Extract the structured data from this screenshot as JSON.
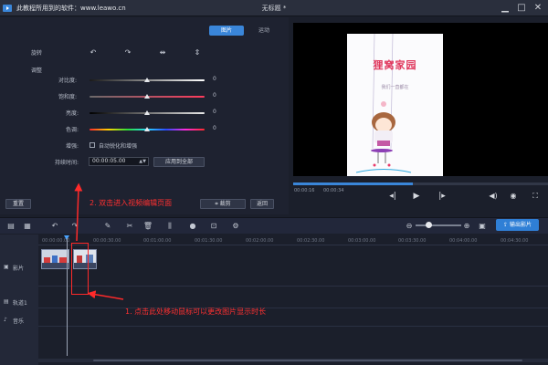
{
  "titlebar": {
    "watermark": "此教程所用到的软件：www.leawo.cn",
    "doc_title": "无标题 *",
    "minimize": "▁",
    "maximize": "□",
    "close": "✕"
  },
  "tabs": {
    "active": "图片",
    "inactive": "运动"
  },
  "props": {
    "rotate_label": "旋转",
    "adjust_label": "调整",
    "contrast": {
      "label": "对比度:",
      "value": "0",
      "level": 0.5
    },
    "saturation": {
      "label": "饱和度:",
      "value": "0",
      "level": 0.5
    },
    "brightness": {
      "label": "亮度:",
      "value": "0",
      "level": 0.5
    },
    "hue": {
      "label": "色调:",
      "value": "0",
      "level": 0.5
    },
    "enhance_label": "增强:",
    "auto_enhance": "自动锐化和增强",
    "duration_label": "持续时间:",
    "duration_value": "00:00:05.00",
    "apply_all": "应用到全部",
    "reset": "重置",
    "crop": "裁剪",
    "back": "返回"
  },
  "preview": {
    "card_title": "狸窝家园",
    "card_sub": "我们一直都在",
    "time_current": "00:00:16",
    "time_total": "00:00:34",
    "progress": 0.47
  },
  "toolbar": {
    "export_label": "输出影片"
  },
  "timeline": {
    "ruler_ticks": [
      "00:00:00.00",
      "00:00:30.00",
      "00:01:00.00",
      "00:01:30.00",
      "00:02:00.00",
      "00:02:30.00",
      "00:03:00.00",
      "00:03:30.00",
      "00:04:00.00",
      "00:04:30.00"
    ],
    "track_video": "影片",
    "track_overlay": "轨道1",
    "track_music": "音乐"
  },
  "annotations": {
    "step1": "1. 点击此处移动鼠标可以更改图片显示时长",
    "step2": "2. 双击进入视频编辑页面"
  },
  "colors": {
    "accent": "#3a86d9",
    "annotation": "#ff2a2a",
    "card_title": "#e0375c"
  }
}
